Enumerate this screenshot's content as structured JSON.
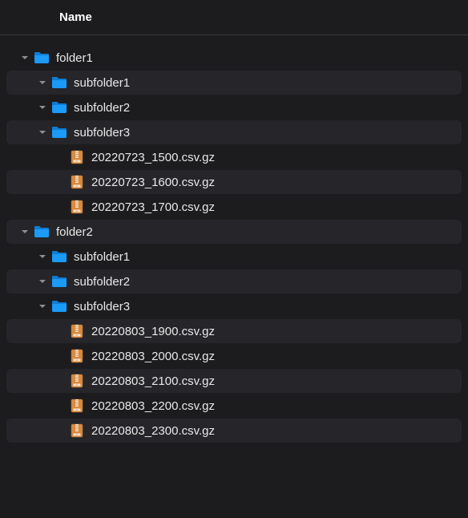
{
  "header": {
    "name_column": "Name"
  },
  "tree": [
    {
      "type": "folder",
      "label": "folder1",
      "indent": 0,
      "expanded": true,
      "alt": false
    },
    {
      "type": "folder",
      "label": "subfolder1",
      "indent": 1,
      "expanded": true,
      "alt": true
    },
    {
      "type": "folder",
      "label": "subfolder2",
      "indent": 1,
      "expanded": true,
      "alt": false
    },
    {
      "type": "folder",
      "label": "subfolder3",
      "indent": 1,
      "expanded": true,
      "alt": true
    },
    {
      "type": "file",
      "label": "20220723_1500.csv.gz",
      "indent": 2,
      "alt": false
    },
    {
      "type": "file",
      "label": "20220723_1600.csv.gz",
      "indent": 2,
      "alt": true
    },
    {
      "type": "file",
      "label": "20220723_1700.csv.gz",
      "indent": 2,
      "alt": false
    },
    {
      "type": "folder",
      "label": "folder2",
      "indent": 0,
      "expanded": true,
      "alt": true
    },
    {
      "type": "folder",
      "label": "subfolder1",
      "indent": 1,
      "expanded": true,
      "alt": false
    },
    {
      "type": "folder",
      "label": "subfolder2",
      "indent": 1,
      "expanded": true,
      "alt": true
    },
    {
      "type": "folder",
      "label": "subfolder3",
      "indent": 1,
      "expanded": true,
      "alt": false
    },
    {
      "type": "file",
      "label": "20220803_1900.csv.gz",
      "indent": 2,
      "alt": true
    },
    {
      "type": "file",
      "label": "20220803_2000.csv.gz",
      "indent": 2,
      "alt": false
    },
    {
      "type": "file",
      "label": "20220803_2100.csv.gz",
      "indent": 2,
      "alt": true
    },
    {
      "type": "file",
      "label": "20220803_2200.csv.gz",
      "indent": 2,
      "alt": false
    },
    {
      "type": "file",
      "label": "20220803_2300.csv.gz",
      "indent": 2,
      "alt": true
    }
  ],
  "trailing_spacers": [
    false,
    true
  ]
}
